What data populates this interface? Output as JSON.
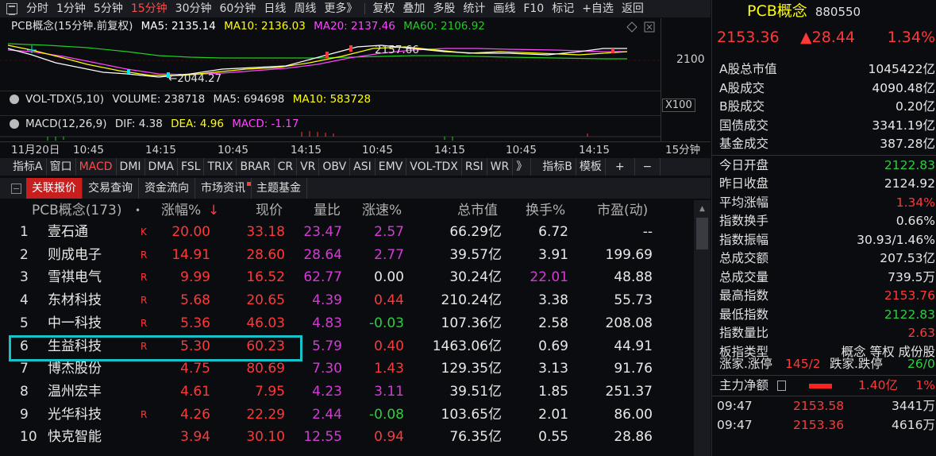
{
  "menu": {
    "items": [
      "分时",
      "1分钟",
      "5分钟",
      "15分钟",
      "30分钟",
      "60分钟",
      "日线",
      "周线",
      "更多》",
      "复权",
      "叠加",
      "多股",
      "统计",
      "画线",
      "F10",
      "标记",
      "+自选",
      "返回"
    ],
    "active_index": 3
  },
  "kline": {
    "title": "PCB概念(15分钟.前复权)",
    "ma5": "MA5: 2135.14",
    "ma10": "MA10: 2136.03",
    "ma20": "MA20: 2137.46",
    "ma60": "MA60: 2106.92",
    "high_label": "2157.66",
    "low_label": "←2044.27",
    "axis_price": "2100",
    "colors": {
      "ma5": "#ffffff",
      "ma10": "#ffff00",
      "ma20": "#ff44ff",
      "ma60": "#22cc22"
    }
  },
  "vol": {
    "label": "VOL-TDX(5,10)",
    "volume": "VOLUME: 238718",
    "ma5": "MA5: 694698",
    "ma10": "MA10: 583728",
    "axis": "X100"
  },
  "macd": {
    "label": "MACD(12,26,9)",
    "dif": "DIF: 4.38",
    "dea": "DEA: 4.96",
    "macd": "MACD: -1.17"
  },
  "timeaxis": {
    "date": "11月20日",
    "ticks": [
      "10:45",
      "14:15",
      "10:45",
      "14:15",
      "10:45",
      "14:15",
      "10:45",
      "14:15"
    ],
    "period": "15分钟"
  },
  "indicators": {
    "items": [
      "指标A",
      "窗口",
      "MACD",
      "DMI",
      "DMA",
      "FSL",
      "TRIX",
      "BRAR",
      "CR",
      "VR",
      "OBV",
      "ASI",
      "EMV",
      "VOL-TDX",
      "RSI",
      "WR",
      "》",
      "指标B",
      "模板",
      "+",
      "−"
    ],
    "active_index": 2
  },
  "tabs": {
    "items": [
      "关联报价",
      "交易查询",
      "资金流向",
      "市场资讯",
      "主题基金"
    ],
    "active_index": 0
  },
  "table": {
    "headers": {
      "name": "PCB概念(173)",
      "dot": "•",
      "chg": "涨幅%",
      "arrow": "↓",
      "price": "现价",
      "vr": "量比",
      "speed": "涨速%",
      "cap": "总市值",
      "turn": "换手%",
      "pe": "市盈(动)"
    },
    "rows": [
      {
        "idx": "1",
        "name": "壹石通",
        "flag": "K",
        "chg": "20.00",
        "price": "33.18",
        "vr": "23.47",
        "speed": "2.57",
        "cap": "66.29亿",
        "turn": "6.72",
        "pe": "--",
        "speed_c": "p",
        "turn_c": "w"
      },
      {
        "idx": "2",
        "name": "则成电子",
        "flag": "R",
        "chg": "14.91",
        "price": "28.60",
        "vr": "28.64",
        "speed": "2.77",
        "cap": "39.57亿",
        "turn": "3.91",
        "pe": "199.69",
        "speed_c": "p",
        "turn_c": "w"
      },
      {
        "idx": "3",
        "name": "雪祺电气",
        "flag": "R",
        "chg": "9.99",
        "price": "16.52",
        "vr": "62.77",
        "speed": "0.00",
        "cap": "30.24亿",
        "turn": "22.01",
        "pe": "48.88",
        "speed_c": "w",
        "turn_c": "p"
      },
      {
        "idx": "4",
        "name": "东材科技",
        "flag": "R",
        "chg": "5.68",
        "price": "20.65",
        "vr": "4.39",
        "speed": "0.44",
        "cap": "210.24亿",
        "turn": "3.38",
        "pe": "55.73",
        "speed_c": "r",
        "turn_c": "w"
      },
      {
        "idx": "5",
        "name": "中一科技",
        "flag": "R",
        "chg": "5.36",
        "price": "46.03",
        "vr": "4.83",
        "speed": "-0.03",
        "cap": "107.36亿",
        "turn": "2.58",
        "pe": "208.08",
        "speed_c": "g",
        "turn_c": "w"
      },
      {
        "idx": "6",
        "name": "生益科技",
        "flag": "R",
        "chg": "5.30",
        "price": "60.23",
        "vr": "5.79",
        "speed": "0.40",
        "cap": "1463.06亿",
        "turn": "0.69",
        "pe": "44.91",
        "speed_c": "r",
        "turn_c": "w"
      },
      {
        "idx": "7",
        "name": "博杰股份",
        "flag": "",
        "chg": "4.75",
        "price": "80.69",
        "vr": "7.30",
        "speed": "1.43",
        "cap": "129.35亿",
        "turn": "3.13",
        "pe": "91.76",
        "speed_c": "r",
        "turn_c": "w"
      },
      {
        "idx": "8",
        "name": "温州宏丰",
        "flag": "",
        "chg": "4.61",
        "price": "7.95",
        "vr": "4.23",
        "speed": "3.11",
        "cap": "39.51亿",
        "turn": "1.85",
        "pe": "251.37",
        "speed_c": "p",
        "turn_c": "w"
      },
      {
        "idx": "9",
        "name": "光华科技",
        "flag": "R",
        "chg": "4.26",
        "price": "22.29",
        "vr": "2.44",
        "speed": "-0.08",
        "cap": "103.65亿",
        "turn": "2.01",
        "pe": "86.00",
        "speed_c": "g",
        "turn_c": "w"
      },
      {
        "idx": "10",
        "name": "快克智能",
        "flag": "",
        "chg": "3.94",
        "price": "30.10",
        "vr": "12.55",
        "speed": "0.94",
        "cap": "76.35亿",
        "turn": "0.55",
        "pe": "28.86",
        "speed_c": "r",
        "turn_c": "w"
      }
    ]
  },
  "panel": {
    "name": "PCB概念",
    "code": "880550",
    "price": "2153.36",
    "change": "▲28.44",
    "pct": "1.34%",
    "rows": [
      {
        "k": "A股总市值",
        "v": "1045422亿",
        "c": "w"
      },
      {
        "k": "A股成交",
        "v": "4090.48亿",
        "c": "w"
      },
      {
        "k": "B股成交",
        "v": "0.20亿",
        "c": "w"
      },
      {
        "k": "国债成交",
        "v": "3341.19亿",
        "c": "w"
      },
      {
        "k": "基金成交",
        "v": "387.28亿",
        "c": "w"
      }
    ],
    "rows2": [
      {
        "k": "今日开盘",
        "v": "2122.83",
        "c": "g"
      },
      {
        "k": "昨日收盘",
        "v": "2124.92",
        "c": "w"
      },
      {
        "k": "平均涨幅",
        "v": "1.34%",
        "c": "r"
      },
      {
        "k": "指数换手",
        "v": "0.66%",
        "c": "w"
      },
      {
        "k": "指数振幅",
        "v": "30.93/1.46%",
        "c": "w"
      },
      {
        "k": "总成交额",
        "v": "207.53亿",
        "c": "w"
      },
      {
        "k": "总成交量",
        "v": "739.5万",
        "c": "w"
      },
      {
        "k": "最高指数",
        "v": "2153.76",
        "c": "r"
      },
      {
        "k": "最低指数",
        "v": "2122.83",
        "c": "g"
      },
      {
        "k": "指数量比",
        "v": "2.63",
        "c": "r"
      },
      {
        "k": "板指类型",
        "v": "概念 等权 成份股",
        "c": "w"
      }
    ],
    "updown": {
      "k1": "涨家.涨停",
      "v1": "145/2",
      "k2": "跌家.跌停",
      "v2": "26/0"
    },
    "mainflow": {
      "k": "主力净额",
      "amount": "1.40亿",
      "pct": "1%"
    },
    "ticks": [
      {
        "t": "09:47",
        "p": "2153.58",
        "v": "3441万"
      },
      {
        "t": "09:47",
        "p": "2153.36",
        "v": "4616万"
      }
    ]
  }
}
